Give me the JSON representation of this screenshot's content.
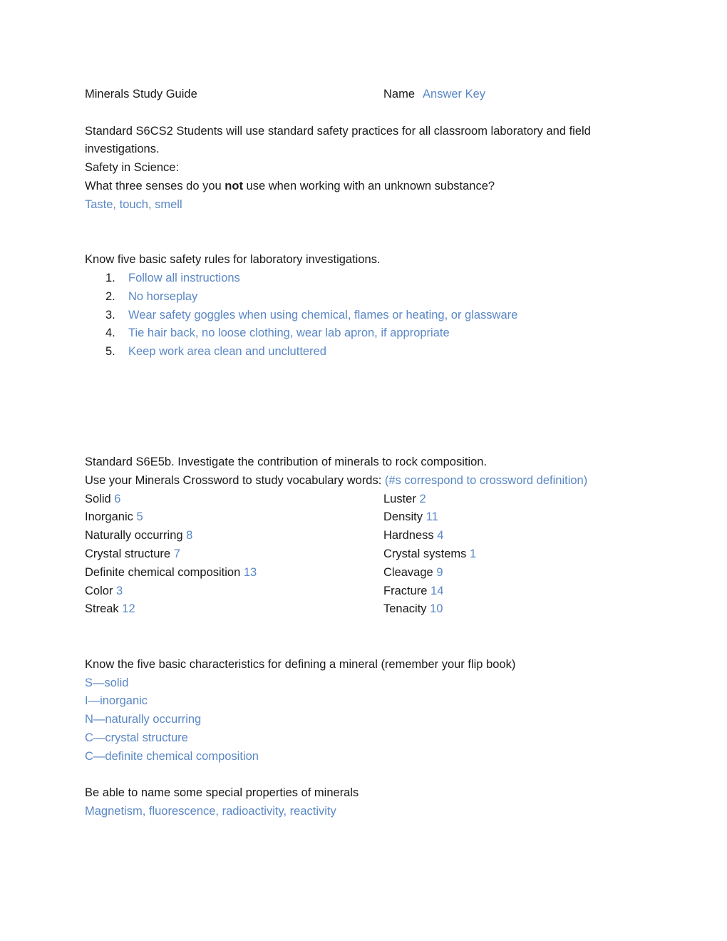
{
  "document": {
    "title": "Minerals Study Guide",
    "name_label": "Name",
    "name_value": "Answer Key"
  },
  "standard_s6cs2": {
    "text_line1": "Standard S6CS2 Students will use standard safety practices for all classroom laboratory and field",
    "text_line2": "investigations.",
    "safety_heading": "Safety in Science:",
    "question_part1": "What three senses do you ",
    "question_bold": "not",
    "question_part2": " use when working with an unknown substance?",
    "answer": "Taste, touch, smell"
  },
  "safety_rules": {
    "heading": "Know five basic safety rules for laboratory investigations.",
    "items": [
      {
        "marker": "1.",
        "text": "Follow all instructions"
      },
      {
        "marker": "2.",
        "text": "No horseplay"
      },
      {
        "marker": "3.",
        "text": "Wear safety goggles when using chemical, flames or heating, or glassware"
      },
      {
        "marker": "4.",
        "text": "Tie hair back, no loose clothing, wear lab apron, if appropriate"
      },
      {
        "marker": "5.",
        "text": "Keep work area clean and uncluttered"
      }
    ]
  },
  "standard_s6e5b": {
    "heading": "Standard S6E5b. Investigate the contribution of minerals to rock composition.",
    "crossword_intro": "Use your Minerals Crossword to study vocabulary words: ",
    "crossword_note": "(#s correspond to crossword definition)"
  },
  "vocabulary": {
    "rows": [
      {
        "left_term": "Solid",
        "left_num": "6",
        "right_term": "Luster",
        "right_num": "2"
      },
      {
        "left_term": "Inorganic",
        "left_num": "5",
        "right_term": "Density",
        "right_num": "11"
      },
      {
        "left_term": "Naturally occurring",
        "left_num": "8",
        "right_term": "Hardness",
        "right_num": "4"
      },
      {
        "left_term": "Crystal structure",
        "left_num": "7",
        "right_term": "Crystal systems",
        "right_num": "1"
      },
      {
        "left_term": "Definite chemical composition",
        "left_num": "13",
        "right_term": "Cleavage",
        "right_num": "9"
      },
      {
        "left_term": "Color",
        "left_num": "3",
        "right_term": "Fracture",
        "right_num": "14"
      },
      {
        "left_term": "Streak",
        "left_num": "12",
        "right_term": "Tenacity",
        "right_num": "10"
      }
    ]
  },
  "characteristics": {
    "heading": "Know the five basic characteristics for defining a mineral (remember your flip book)",
    "items": [
      "S—solid",
      "I—inorganic",
      "N—naturally occurring",
      "C—crystal structure",
      "C—definite chemical composition"
    ]
  },
  "special_properties": {
    "heading": "Be able to name some special properties of minerals",
    "answer": "Magnetism, fluorescence, radioactivity, reactivity"
  }
}
